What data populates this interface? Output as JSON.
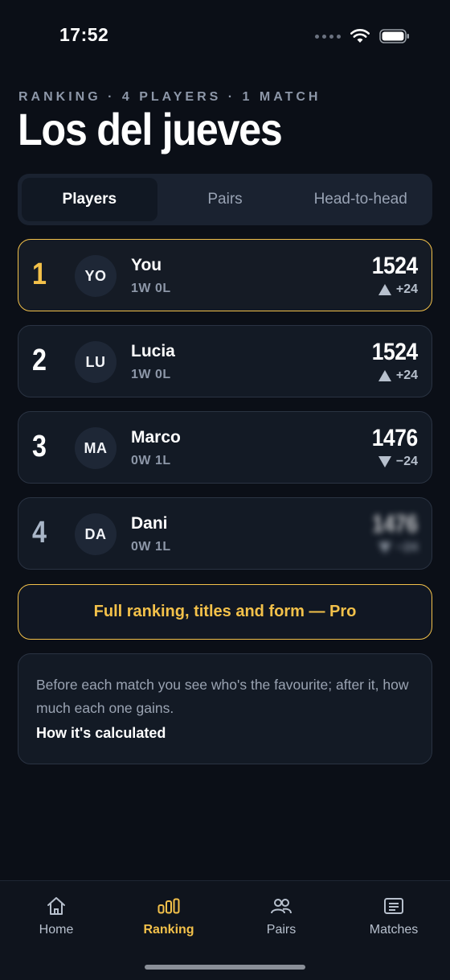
{
  "status_bar": {
    "time": "17:52"
  },
  "header": {
    "overline": "RANKING · 4 PLAYERS · 1 MATCH",
    "title": "Los del jueves"
  },
  "tabs": [
    {
      "label": "Players",
      "active": true
    },
    {
      "label": "Pairs",
      "active": false
    },
    {
      "label": "Head-to-head",
      "active": false
    }
  ],
  "players": [
    {
      "rank": "1",
      "initials": "YO",
      "name": "You",
      "record": "1W 0L",
      "rating": "1524",
      "delta": "+24",
      "trend": "up",
      "highlight": true,
      "locked": false
    },
    {
      "rank": "2",
      "initials": "LU",
      "name": "Lucia",
      "record": "1W 0L",
      "rating": "1524",
      "delta": "+24",
      "trend": "up",
      "highlight": false,
      "locked": false
    },
    {
      "rank": "3",
      "initials": "MA",
      "name": "Marco",
      "record": "0W 1L",
      "rating": "1476",
      "delta": "−24",
      "trend": "down",
      "highlight": false,
      "locked": false
    },
    {
      "rank": "4",
      "initials": "DA",
      "name": "Dani",
      "record": "0W 1L",
      "rating": "1476",
      "delta": "−24",
      "trend": "down",
      "highlight": false,
      "locked": true
    }
  ],
  "pro_button": {
    "label": "Full ranking, titles and form — Pro"
  },
  "info_card": {
    "text": "Before each match you see who's the favourite; after it, how much each one gains.",
    "link": "How it's calculated"
  },
  "bottom_nav": [
    {
      "label": "Home",
      "icon": "home-icon",
      "active": false
    },
    {
      "label": "Ranking",
      "icon": "ranking-icon",
      "active": true
    },
    {
      "label": "Pairs",
      "icon": "pairs-icon",
      "active": false
    },
    {
      "label": "Matches",
      "icon": "matches-icon",
      "active": false
    }
  ],
  "colors": {
    "background": "#0b0f17",
    "accent": "#f3c14a",
    "card": "#131a25",
    "muted_text": "#8d97a8"
  }
}
